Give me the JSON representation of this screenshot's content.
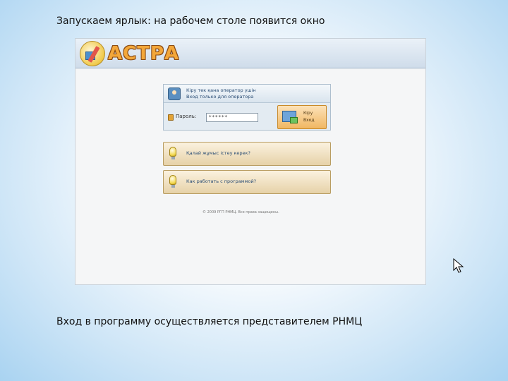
{
  "slide": {
    "caption_top": "Запускаем ярлык: на рабочем столе появится окно",
    "caption_bottom": "Вход в программу осуществляется представителем РНМЦ"
  },
  "app": {
    "logo_text": "АСТРА",
    "login_panel": {
      "header_line_1": "Кіру тек қана оператор үшін",
      "header_line_2": "Вход только для оператора",
      "password_label": "Пароль:",
      "password_value": "******"
    },
    "login_button": {
      "line_1": "Кіру",
      "line_2": "Вход"
    },
    "help_buttons": [
      {
        "label": "Қалай жұмыс істеу керек?"
      },
      {
        "label": "Как работать с программой?"
      }
    ],
    "copyright": "© 2009 РГП РНМЦ. Все права защищены."
  },
  "colors": {
    "logo_fill": "#f3a73a",
    "login_button": "#f0b763",
    "help_button": "#e6d2a8",
    "header_bar": "#cfdcea"
  }
}
